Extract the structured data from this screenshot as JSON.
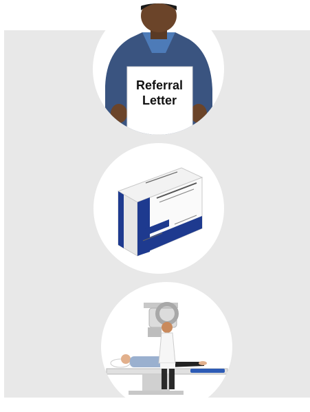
{
  "items": [
    {
      "icon": "referral-letter-person-icon",
      "sign_line1": "Referral",
      "sign_line2": "Letter"
    },
    {
      "icon": "medicine-box-icon"
    },
    {
      "icon": "xray-scan-icon"
    }
  ],
  "colors": {
    "panel": "#e8e8e8",
    "circle": "#ffffff",
    "hoodie": "#3a5480",
    "shirt": "#4d7bb8",
    "box_blue": "#1e3a8f"
  }
}
